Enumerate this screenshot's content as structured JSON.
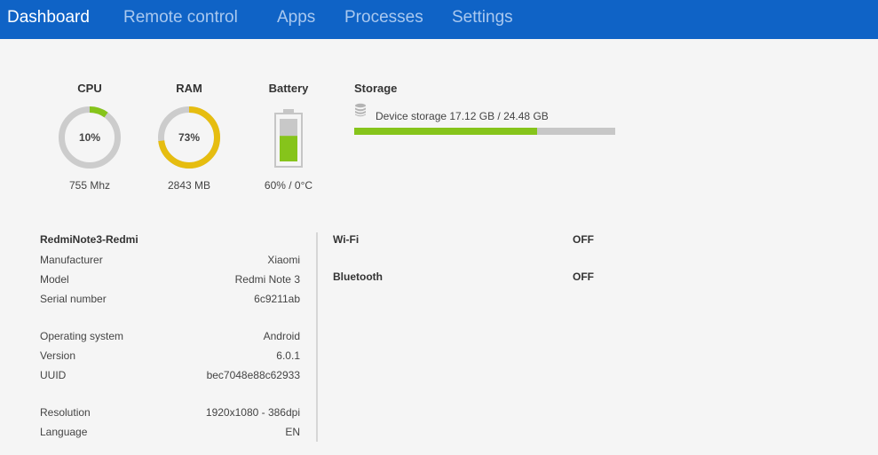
{
  "nav": {
    "tabs": [
      {
        "label": "Dashboard",
        "active": true
      },
      {
        "label": "Remote control",
        "active": false
      },
      {
        "label": "Apps",
        "active": false
      },
      {
        "label": "Processes",
        "active": false
      },
      {
        "label": "Settings",
        "active": false
      }
    ],
    "colors": {
      "bar": "#0f63c6",
      "active": "#ffffff",
      "inactive": "#a9c8ef"
    }
  },
  "gauges": {
    "cpu": {
      "title": "CPU",
      "percent_label": "10%",
      "percent": 10,
      "value": "755 Mhz",
      "color": "#86c41b"
    },
    "ram": {
      "title": "RAM",
      "percent_label": "73%",
      "percent": 73,
      "value": "2843 MB",
      "color": "#e6bd10"
    },
    "battery": {
      "title": "Battery",
      "level": 60,
      "value": "60% / 0°C",
      "color": "#86c41b"
    }
  },
  "storage": {
    "title": "Storage",
    "icon": "database-icon",
    "label": "Device storage 17.12 GB / 24.48 GB",
    "used_fraction": 0.699,
    "color": "#86c41b"
  },
  "device": {
    "name": "RedmiNote3-Redmi",
    "rows": [
      {
        "label": "Manufacturer",
        "value": "Xiaomi"
      },
      {
        "label": "Model",
        "value": "Redmi Note 3"
      },
      {
        "label": "Serial number",
        "value": "6c9211ab"
      },
      {
        "label": "Operating system",
        "value": "Android"
      },
      {
        "label": "Version",
        "value": "6.0.1"
      },
      {
        "label": "UUID",
        "value": "bec7048e88c62933"
      },
      {
        "label": "Resolution",
        "value": "1920x1080 - 386dpi"
      },
      {
        "label": "Language",
        "value": "EN"
      }
    ]
  },
  "connectivity": [
    {
      "label": "Wi-Fi",
      "value": "OFF"
    },
    {
      "label": "Bluetooth",
      "value": "OFF"
    }
  ]
}
